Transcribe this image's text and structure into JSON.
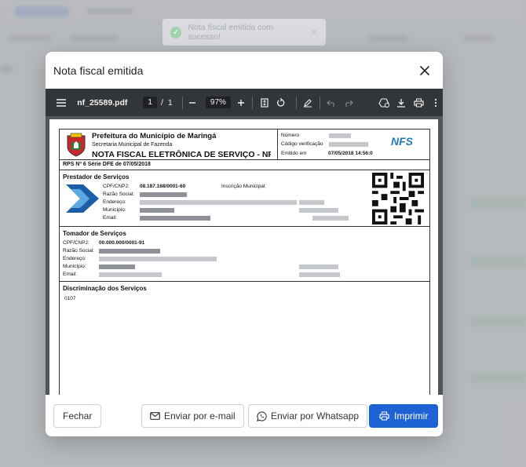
{
  "toast": {
    "message": "Nota fiscal emitida com sucesso!"
  },
  "modal": {
    "title": "Nota fiscal emitida",
    "buttons": {
      "close": "Fechar",
      "email": "Enviar por e-mail",
      "whatsapp": "Enviar por Whatsapp",
      "print": "Imprimir"
    }
  },
  "pdf_toolbar": {
    "filename": "nf_25589.pdf",
    "current_page": "1",
    "page_separator": "/",
    "total_pages": "1",
    "zoom": "97%"
  },
  "document": {
    "prefeitura": "Prefeitura do Município de Maringá",
    "secretaria": "Secretaria Municipal de Fazenda",
    "doc_title": "NOTA FISCAL ELETRÔNICA DE SERVIÇO - NFS",
    "numero_label": "Número",
    "codigo_label": "Código verificação",
    "emitido_label": "Emitido em",
    "emitido_value": "07/05/2018 14:56:0",
    "nfse_logo": "NFS",
    "rps_line": "RPS Nº 6 Série DFE de 07/05/2018",
    "prestador": {
      "title": "Prestador de Serviços",
      "cpf_label": "CPF/CNPJ:",
      "cpf_value": "08.187.168/0001-60",
      "razao_label": "Razão Social:",
      "endereco_label": "Endereço:",
      "municipio_label": "Município:",
      "email_label": "Email:",
      "inscricao_label": "Inscrição Municipal:"
    },
    "tomador": {
      "title": "Tomador de Serviços",
      "cpf_label": "CPF/CNPJ:",
      "cpf_value": "00.000.000/0001-91",
      "razao_label": "Razão Social:",
      "endereco_label": "Endereço:",
      "municipio_label": "Município:",
      "email_label": "Email:"
    },
    "discriminacao": {
      "title": "Discriminação dos Serviços",
      "code": "0107"
    }
  }
}
